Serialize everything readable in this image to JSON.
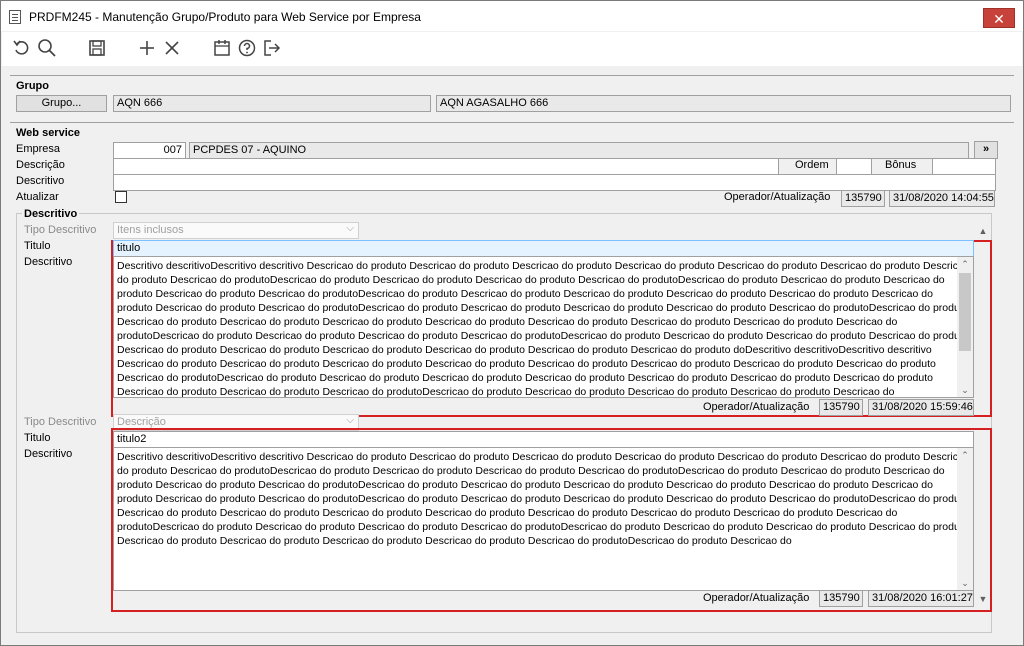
{
  "window": {
    "title": "PRDFM245 - Manutenção Grupo/Produto para Web Service por Empresa",
    "close_label": "✕"
  },
  "toolbar": {
    "icons": [
      "undo-icon",
      "search-icon",
      "save-icon",
      "add-icon",
      "delete-icon",
      "calendar-icon",
      "help-icon",
      "exit-icon"
    ]
  },
  "grupo": {
    "section_label": "Grupo",
    "button_label": "Grupo...",
    "code": "AQN 666",
    "name": "AQN AGASALHO 666"
  },
  "webservice": {
    "section_label": "Web service",
    "empresa_label": "Empresa",
    "empresa_code": "007",
    "empresa_name": "PCPDES 07 - AQUINO",
    "next_label": "»",
    "descricao_label": "Descrição",
    "descricao_value": "",
    "ordem_label": "Ordem",
    "ordem_value": "",
    "bonus_label": "Bônus",
    "bonus_value": "",
    "descritivo_label": "Descritivo",
    "descritivo_value": "",
    "atualizar_label": "Atualizar",
    "operador_label": "Operador/Atualização",
    "operador_value": "135790",
    "data_value": "31/08/2020 14:04:55"
  },
  "descritivo_group": {
    "section_label": "Descritivo",
    "items": [
      {
        "tipo_label": "Tipo Descritivo",
        "tipo_value": "Itens inclusos",
        "titulo_label": "Titulo",
        "titulo_value": "titulo",
        "descritivo_label": "Descritivo",
        "text": "Descritivo descritivoDescritivo descritivo Descricao do produto Descricao do produto Descricao do produto Descricao do produto Descricao do produto Descricao do produto Descricao do produto Descricao do produtoDescricao do produto Descricao do produto Descricao do produto Descricao do produtoDescricao do produto Descricao do produto Descricao do produto Descricao do produto Descricao do produtoDescricao do produto Descricao do produto Descricao do produto Descricao do produto Descricao do produto Descricao do produto Descricao do produto Descricao do produtoDescricao do produto Descricao do produto Descricao do produto Descricao do produto Descricao do produtoDescricao do produto Descricao do produto Descricao do produto Descricao do produto Descricao do produto Descricao do produto Descricao do produto Descricao do produto Descricao do produtoDescricao do produto Descricao do produto Descricao do produto Descricao do produtoDescricao do produto Descricao do produto Descricao do produto Descricao do produto Descricao do produto Descricao do produto Descricao do produto Descricao do produto Descricao do produto Descricao do produto doDescritivo descritivoDescritivo descritivo Descricao do produto Descricao do produto Descricao do produto Descricao do produto Descricao do produto Descricao do produto Descricao do produto Descricao do produto Descricao do produtoDescricao do produto Descricao do produto Descricao do produto Descricao do produto Descricao do produto Descricao do produto Descricao do produto Descricao do produto Descricao do produto Descricao do produtoDescricao do produto Descricao do produto Descricao do produto Descricao do produto Descricao do produtoDescricao do produto Descricao do produto Descricao do produto Descricao do produto Descricao do produto Descricao do produto Descricao do produto Descricao do produto Descricao do produto",
        "operador_label": "Operador/Atualização",
        "operador_value": "135790",
        "data_value": "31/08/2020 15:59:46"
      },
      {
        "tipo_label": "Tipo Descritivo",
        "tipo_value": "Descrição",
        "titulo_label": "Titulo",
        "titulo_value": "titulo2",
        "descritivo_label": "Descritivo",
        "text": "Descritivo descritivoDescritivo descritivo Descricao do produto Descricao do produto Descricao do produto Descricao do produto Descricao do produto Descricao do produto Descricao do produto Descricao do produtoDescricao do produto Descricao do produto Descricao do produto Descricao do produtoDescricao do produto Descricao do produto Descricao do produto Descricao do produto Descricao do produtoDescricao do produto Descricao do produto Descricao do produto Descricao do produto Descricao do produto Descricao do produto Descricao do produto Descricao do produtoDescricao do produto Descricao do produto Descricao do produto Descricao do produto Descricao do produtoDescricao do produto Descricao do produto Descricao do produto Descricao do produto Descricao do produto Descricao do produto Descricao do produto Descricao do produto Descricao do produtoDescricao do produto Descricao do produto Descricao do produto Descricao do produtoDescricao do produto Descricao do produto Descricao do produto Descricao do produto Descricao do produto Descricao do produto Descricao do produto Descricao do produto Descricao do produtoDescricao do produto Descricao do",
        "operador_label": "Operador/Atualização",
        "operador_value": "135790",
        "data_value": "31/08/2020 16:01:27"
      }
    ]
  }
}
